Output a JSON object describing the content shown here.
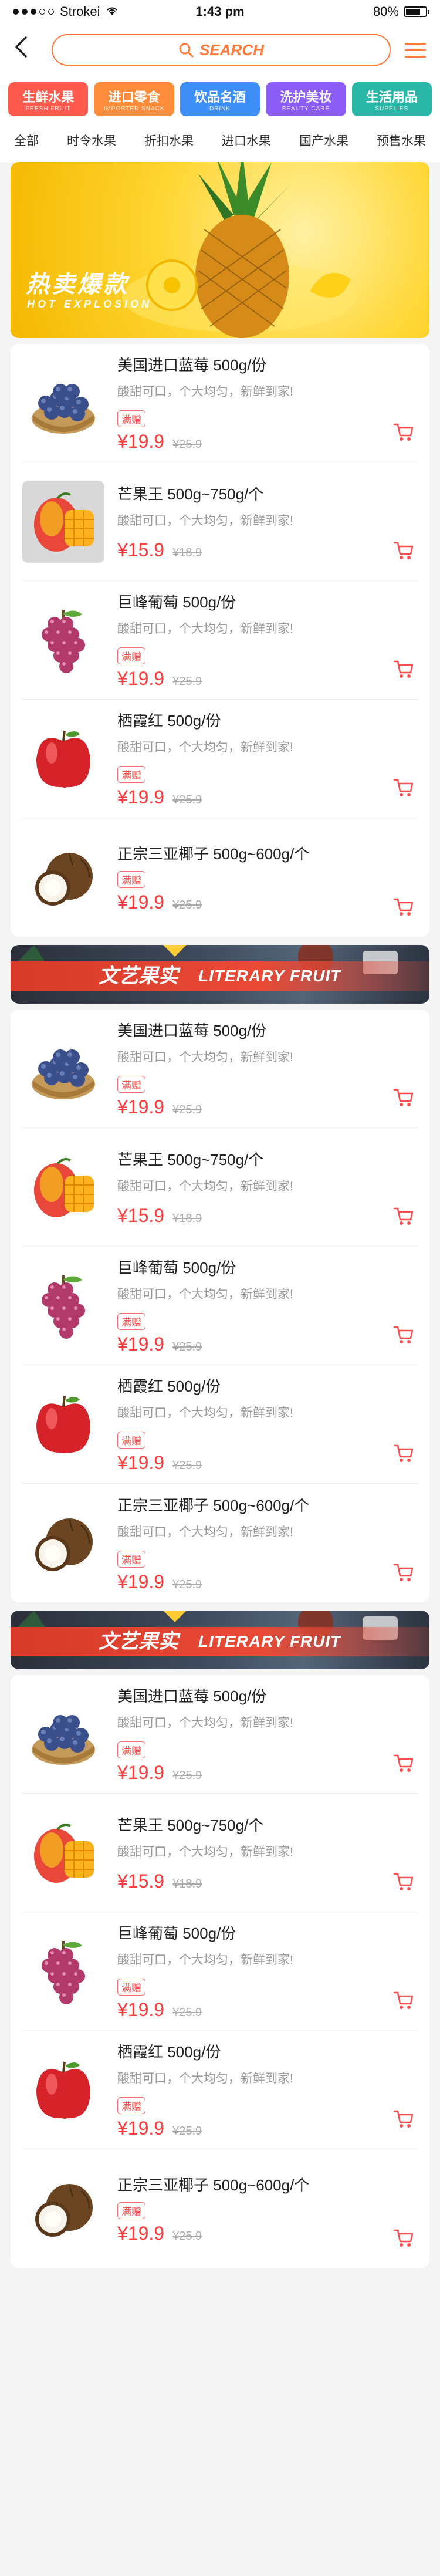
{
  "status_bar": {
    "carrier": "Strokei",
    "time": "1:43 pm",
    "battery": "80%"
  },
  "header": {
    "search_placeholder": "SEARCH"
  },
  "categories": [
    {
      "title": "生鲜水果",
      "sub": "FRESH FRUIT",
      "color": "#ff5a4e"
    },
    {
      "title": "进口零食",
      "sub": "IMPORTED SNACK",
      "color": "#ff8c3a"
    },
    {
      "title": "饮品名酒",
      "sub": "DRINK",
      "color": "#3e8ef7"
    },
    {
      "title": "洗护美妆",
      "sub": "BEAUTY CARE",
      "color": "#8b5cf6"
    },
    {
      "title": "生活用品",
      "sub": "SUPPLIES",
      "color": "#2bb7a8"
    }
  ],
  "tabs": [
    "全部",
    "时令水果",
    "折扣水果",
    "进口水果",
    "国产水果",
    "预售水果"
  ],
  "hero": {
    "title": "热卖爆款",
    "subtitle": "HOT EXPLOSION"
  },
  "banners": [
    {
      "cn": "文艺果实",
      "en": "LITERARY FRUIT"
    },
    {
      "cn": "文艺果实",
      "en": "LITERARY FRUIT"
    }
  ],
  "sections": [
    {
      "products": [
        {
          "name": "美国进口蓝莓 500g/份",
          "desc": "酸甜可口，个大均匀，新鲜到家!",
          "tag": "满赠",
          "price": "¥19.9",
          "old": "¥25.9",
          "fruit": "blueberry"
        },
        {
          "name": "芒果王 500g~750g/个",
          "desc": "酸甜可口，个大均匀，新鲜到家!",
          "tag": "",
          "price": "¥15.9",
          "old": "¥18.9",
          "fruit": "mango"
        },
        {
          "name": "巨峰葡萄 500g/份",
          "desc": "酸甜可口，个大均匀，新鲜到家!",
          "tag": "满赠",
          "price": "¥19.9",
          "old": "¥25.9",
          "fruit": "grape"
        },
        {
          "name": "栖霞红 500g/份",
          "desc": "酸甜可口，个大均匀，新鲜到家!",
          "tag": "满赠",
          "price": "¥19.9",
          "old": "¥25.9",
          "fruit": "apple"
        },
        {
          "name": "正宗三亚椰子 500g~600g/个",
          "desc": "",
          "tag": "满赠",
          "price": "¥19.9",
          "old": "¥25.9",
          "fruit": "coconut"
        }
      ]
    },
    {
      "products": [
        {
          "name": "美国进口蓝莓 500g/份",
          "desc": "酸甜可口，个大均匀，新鲜到家!",
          "tag": "满赠",
          "price": "¥19.9",
          "old": "¥25.9",
          "fruit": "blueberry"
        },
        {
          "name": "芒果王 500g~750g/个",
          "desc": "酸甜可口，个大均匀，新鲜到家!",
          "tag": "",
          "price": "¥15.9",
          "old": "¥18.9",
          "fruit": "mango"
        },
        {
          "name": "巨峰葡萄 500g/份",
          "desc": "酸甜可口，个大均匀，新鲜到家!",
          "tag": "满赠",
          "price": "¥19.9",
          "old": "¥25.9",
          "fruit": "grape"
        },
        {
          "name": "栖霞红 500g/份",
          "desc": "酸甜可口，个大均匀，新鲜到家!",
          "tag": "满赠",
          "price": "¥19.9",
          "old": "¥25.9",
          "fruit": "apple"
        },
        {
          "name": "正宗三亚椰子 500g~600g/个",
          "desc": "酸甜可口，个大均匀，新鲜到家!",
          "tag": "满赠",
          "price": "¥19.9",
          "old": "¥25.9",
          "fruit": "coconut"
        }
      ]
    },
    {
      "products": [
        {
          "name": "美国进口蓝莓 500g/份",
          "desc": "酸甜可口，个大均匀，新鲜到家!",
          "tag": "满赠",
          "price": "¥19.9",
          "old": "¥25.9",
          "fruit": "blueberry"
        },
        {
          "name": "芒果王 500g~750g/个",
          "desc": "酸甜可口，个大均匀，新鲜到家!",
          "tag": "",
          "price": "¥15.9",
          "old": "¥18.9",
          "fruit": "mango"
        },
        {
          "name": "巨峰葡萄 500g/份",
          "desc": "酸甜可口，个大均匀，新鲜到家!",
          "tag": "满赠",
          "price": "¥19.9",
          "old": "¥25.9",
          "fruit": "grape"
        },
        {
          "name": "栖霞红 500g/份",
          "desc": "酸甜可口，个大均匀，新鲜到家!",
          "tag": "满赠",
          "price": "¥19.9",
          "old": "¥25.9",
          "fruit": "apple"
        },
        {
          "name": "正宗三亚椰子 500g~600g/个",
          "desc": "",
          "tag": "满赠",
          "price": "¥19.9",
          "old": "¥25.9",
          "fruit": "coconut"
        }
      ]
    }
  ]
}
